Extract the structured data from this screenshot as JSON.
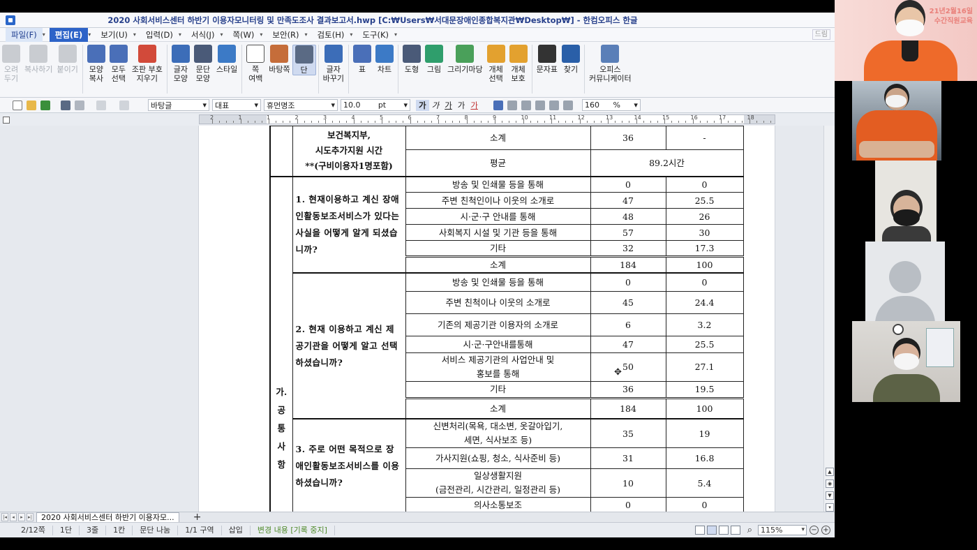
{
  "window": {
    "title": "2020 사회서비스센터 하반기 이용자모니터링 및 만족도조사 결과보고서.hwp [C:₩Users₩서대문장애인종합복지관₩Desktop₩] - 한컴오피스 한글"
  },
  "menu": {
    "items": [
      "파일(F)",
      "편집(E)",
      "보기(U)",
      "입력(D)",
      "서식(J)",
      "쪽(W)",
      "보안(R)",
      "검토(H)",
      "도구(K)"
    ],
    "right_label": "드림"
  },
  "ribbon": {
    "buttons": [
      {
        "label": "오려\n두기",
        "icon": "scissors-icon",
        "enabled": false
      },
      {
        "label": "복사하기",
        "icon": "copy-icon",
        "enabled": false
      },
      {
        "label": "붙이기",
        "icon": "paste-icon",
        "enabled": false
      },
      {
        "label": "모양\n복사",
        "icon": "format-painter-icon",
        "enabled": true
      },
      {
        "label": "모두\n선택",
        "icon": "select-all-icon",
        "enabled": true
      },
      {
        "label": "조판 부호\n지우기",
        "icon": "clear-codes-icon",
        "enabled": true
      },
      {
        "label": "글자\n모양",
        "icon": "char-shape-icon",
        "enabled": true
      },
      {
        "label": "문단\n모양",
        "icon": "paragraph-shape-icon",
        "enabled": true
      },
      {
        "label": "스타일",
        "icon": "style-icon",
        "enabled": true
      },
      {
        "label": "쪽\n여백",
        "icon": "page-margin-icon",
        "enabled": true
      },
      {
        "label": "바탕쪽",
        "icon": "master-page-icon",
        "enabled": true
      },
      {
        "label": "단",
        "icon": "columns-icon",
        "enabled": true
      },
      {
        "label": "글자\n바꾸기",
        "icon": "replace-char-icon",
        "enabled": true
      },
      {
        "label": "표",
        "icon": "table-icon",
        "enabled": true
      },
      {
        "label": "차트",
        "icon": "chart-icon",
        "enabled": true
      },
      {
        "label": "도형",
        "icon": "shape-icon",
        "enabled": true
      },
      {
        "label": "그림",
        "icon": "picture-icon",
        "enabled": true
      },
      {
        "label": "그리기마당",
        "icon": "clipart-icon",
        "enabled": true
      },
      {
        "label": "개체\n선택",
        "icon": "object-select-icon",
        "enabled": true
      },
      {
        "label": "개체\n보호",
        "icon": "object-protect-icon",
        "enabled": true
      },
      {
        "label": "문자표",
        "icon": "symbol-icon",
        "enabled": true
      },
      {
        "label": "찾기",
        "icon": "find-icon",
        "enabled": true
      },
      {
        "label": "오피스\n커뮤니케이터",
        "icon": "communicator-icon",
        "enabled": true
      }
    ]
  },
  "format_bar": {
    "style": "바탕글",
    "lang": "대표",
    "font": "휴먼명조",
    "size": "10.0",
    "unit": "pt",
    "char_buttons": [
      "가",
      "가",
      "가",
      "가",
      "가"
    ],
    "zoom": "160",
    "zoom_unit": "%"
  },
  "ruler": {
    "labels": [
      "2",
      "1",
      "1",
      "2",
      "3",
      "4",
      "5",
      "6",
      "7",
      "8",
      "9",
      "10",
      "11",
      "12",
      "13",
      "14",
      "15",
      "16",
      "17",
      "18"
    ]
  },
  "table": {
    "top_block": {
      "title": "보건복지부,\n시도추가지원 시간\n**(구비이용자1명포함)",
      "rows": [
        {
          "label": "소계",
          "n": "36",
          "pct": "-"
        },
        {
          "label": "평균",
          "merged": "89.2시간"
        }
      ]
    },
    "category": "가.\n공\n통\n사\n항",
    "questions": [
      {
        "text": "1. 현재이용하고 계신 장애인활동보조서비스가 있다는 사실을 어떻게 알게 되셨습니까?",
        "rows": [
          {
            "label": "방송 및 인쇄물 등을 통해",
            "n": "0",
            "pct": "0"
          },
          {
            "label": "주변 친척인이나 이웃의 소개로",
            "n": "47",
            "pct": "25.5"
          },
          {
            "label": "시·군·구 안내를 통해",
            "n": "48",
            "pct": "26"
          },
          {
            "label": "사회복지 시설 및 기관 등을 통해",
            "n": "57",
            "pct": "30"
          },
          {
            "label": "기타",
            "n": "32",
            "pct": "17.3"
          },
          {
            "label": "소계",
            "n": "184",
            "pct": "100"
          }
        ]
      },
      {
        "text": "2. 현재 이용하고 계신 제공기관을 어떻게 알고 선택하셨습니까?",
        "rows": [
          {
            "label": "방송 및 인쇄물 등을 통해",
            "n": "0",
            "pct": "0"
          },
          {
            "label": "주변 친척이나 이웃의 소개로",
            "n": "45",
            "pct": "24.4"
          },
          {
            "label": "기존의 제공기관 이용자의 소개로",
            "n": "6",
            "pct": "3.2"
          },
          {
            "label": "시·군·구안내를통해",
            "n": "47",
            "pct": "25.5"
          },
          {
            "label": "서비스 제공기관의 사업안내 및\n홍보를 통해",
            "n": "50",
            "pct": "27.1"
          },
          {
            "label": "기타",
            "n": "36",
            "pct": "19.5"
          },
          {
            "label": "소계",
            "n": "184",
            "pct": "100"
          }
        ]
      },
      {
        "text": "3. 주로 어떤 목적으로 장애인활동보조서비스를 이용하셨습니까?",
        "rows": [
          {
            "label": "신변처리(목욕, 대소변, 옷갈아입기,\n세면, 식사보조 등)",
            "n": "35",
            "pct": "19"
          },
          {
            "label": "가사지원(쇼핑, 청소, 식사준비 등)",
            "n": "31",
            "pct": "16.8"
          },
          {
            "label": "일상생활지원\n(금전관리, 시간관리, 일정관리 등)",
            "n": "10",
            "pct": "5.4"
          },
          {
            "label": "의사소통보조",
            "n": "0",
            "pct": "0"
          }
        ]
      }
    ]
  },
  "tabbar": {
    "doc_tab": "2020 사회서비스센터 하반기 이용자모...",
    "add": "+"
  },
  "status": {
    "page": "2/12쪽",
    "col": "1단",
    "line": "3줄",
    "char": "1칸",
    "para": "문단 나눔",
    "section": "1/1 구역",
    "mode": "삽입",
    "track": "변경 내용 [기록 중지]",
    "zoom": "115%"
  },
  "video": {
    "banner": "21년2월16일\n수간직원교육"
  },
  "colors": {
    "accent": "#2d63c8",
    "title_text": "#27408b",
    "status_green": "#4f8a2a"
  }
}
